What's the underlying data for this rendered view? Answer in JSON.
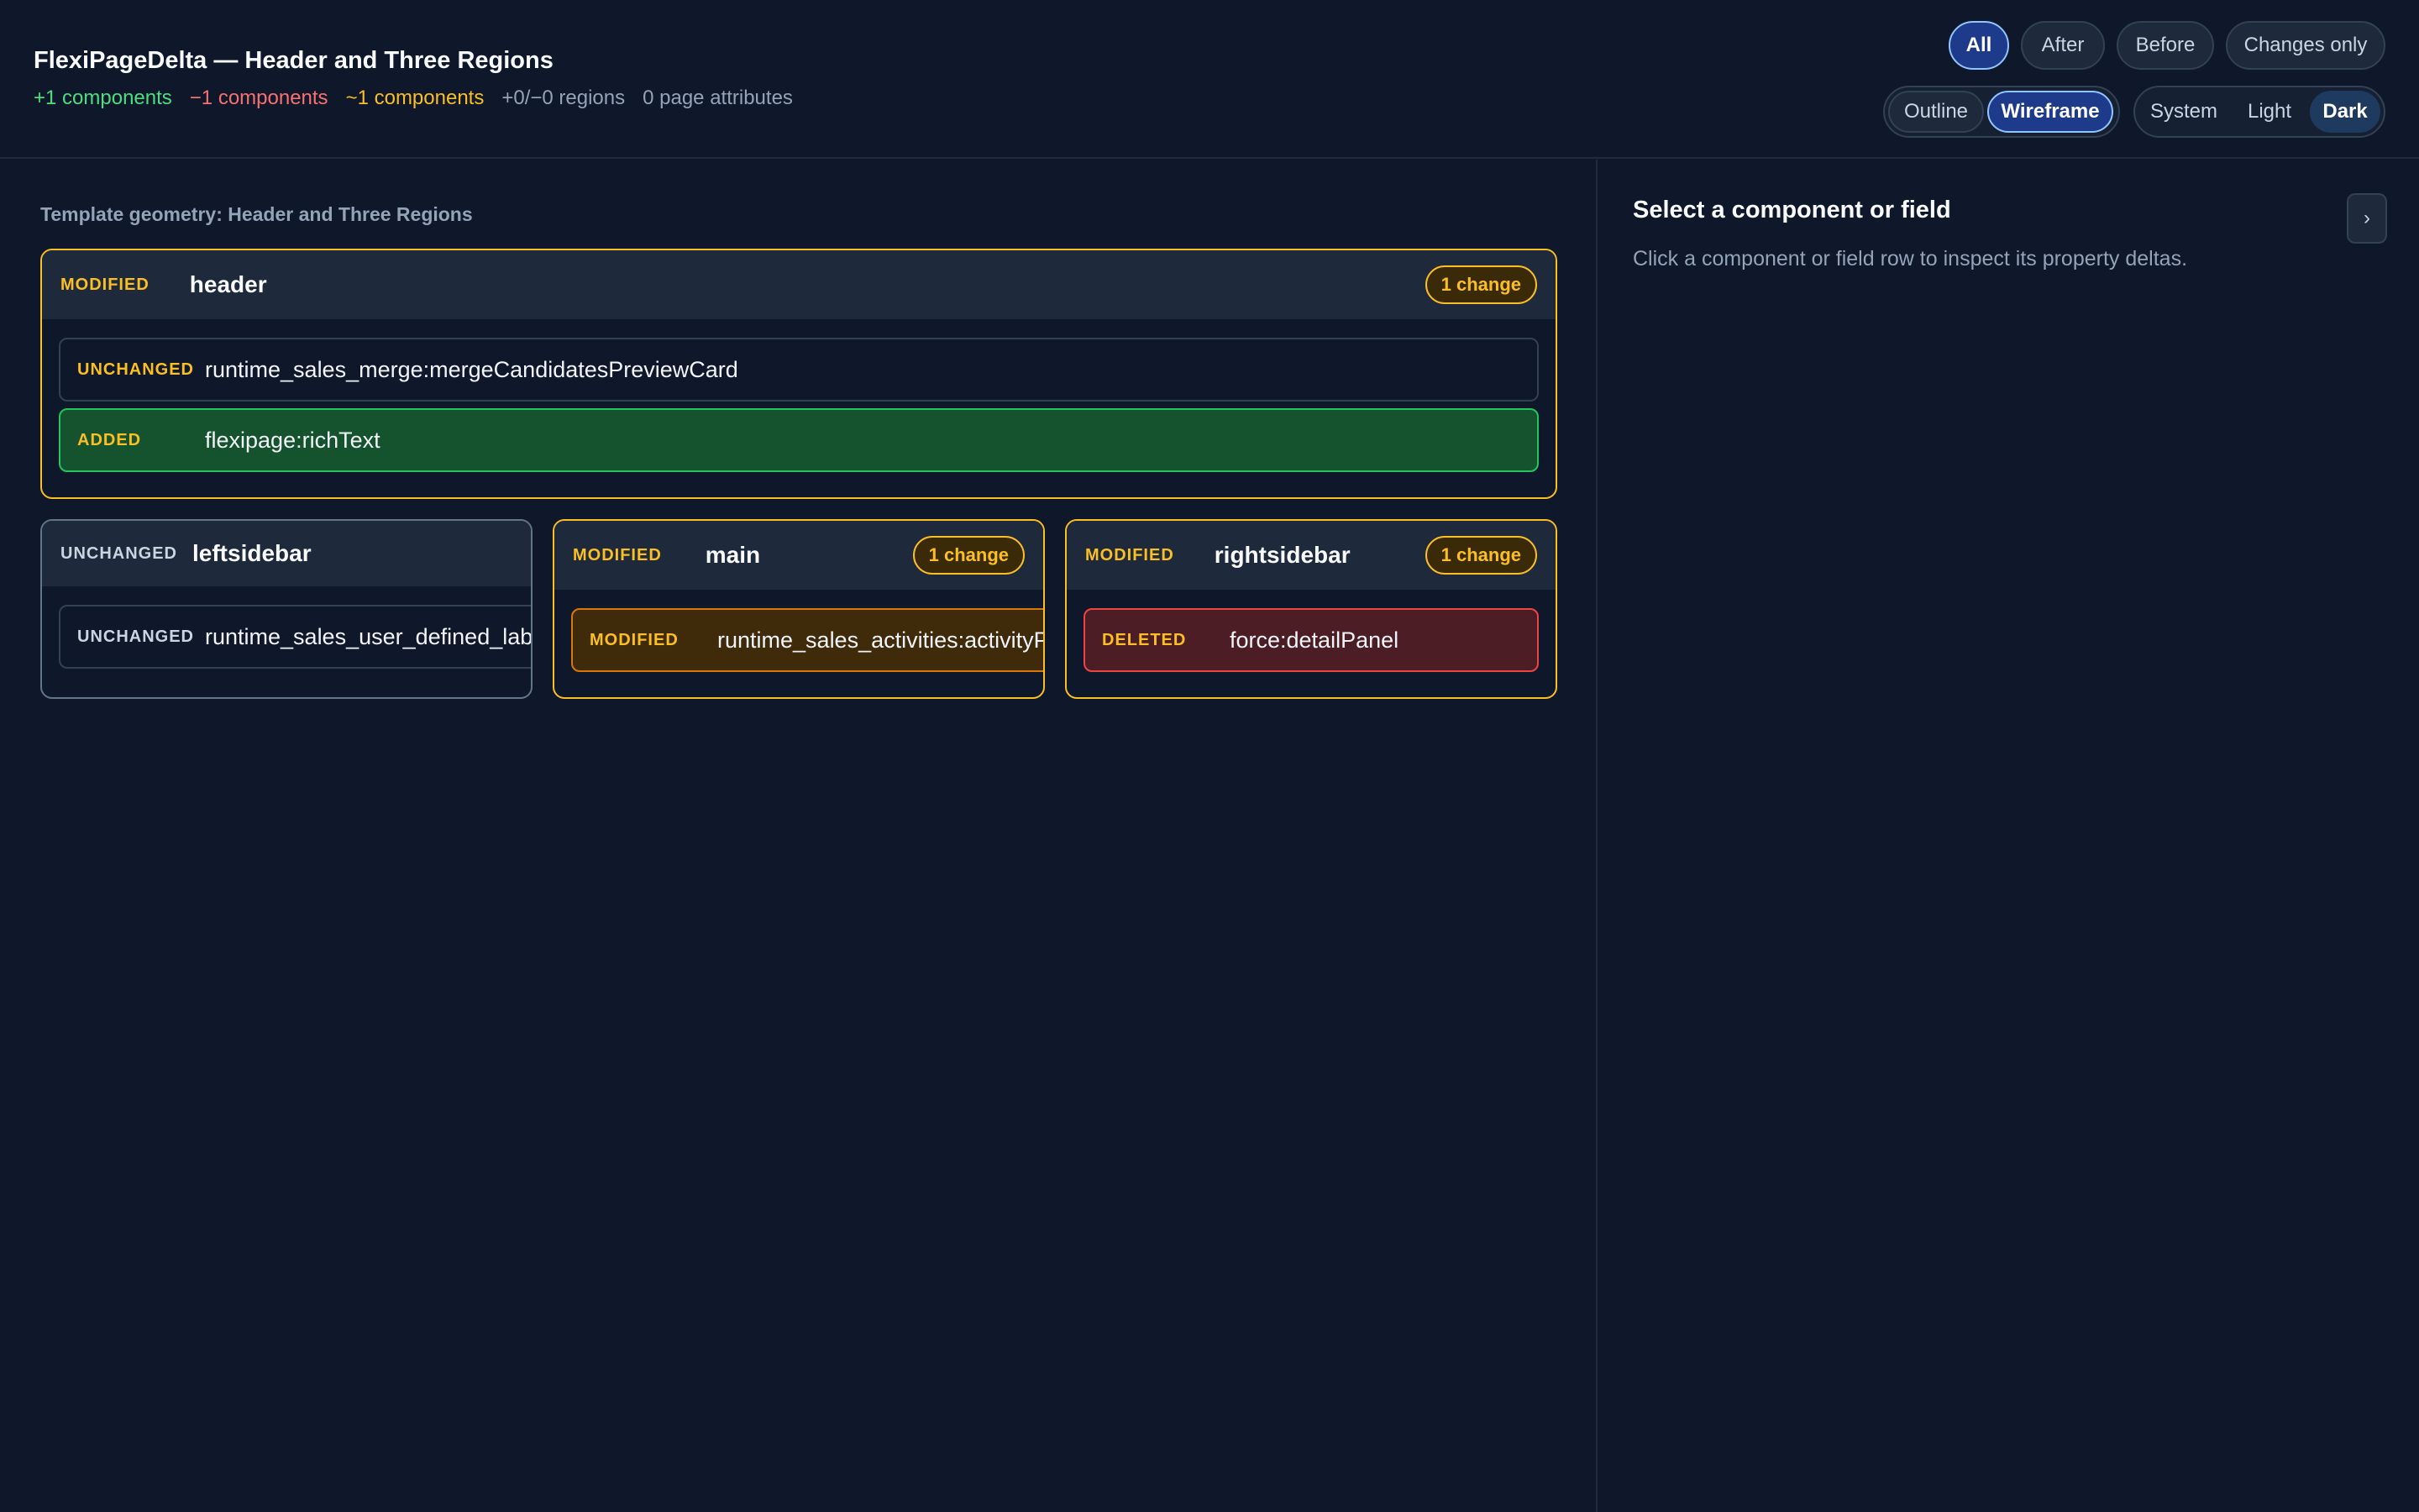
{
  "header": {
    "title": "FlexiPageDelta — Header and Three Regions",
    "summary": {
      "added": "+1 components",
      "deleted": "−1 components",
      "modified": "~1 components",
      "regions": "+0/−0 regions",
      "attributes": "0 page attributes"
    }
  },
  "filters": {
    "all": "All",
    "after": "After",
    "before": "Before",
    "changes_only": "Changes only",
    "selected": "All"
  },
  "view_modes": {
    "outline": "Outline",
    "wireframe": "Wireframe",
    "selected": "Wireframe"
  },
  "themes": {
    "system": "System",
    "light": "Light",
    "dark": "Dark",
    "selected": "Dark"
  },
  "canvas": {
    "geometry_label": "Template geometry: Header and Three Regions",
    "regions": {
      "header": {
        "status": "MODIFIED",
        "name": "header",
        "badge": "1 change",
        "components": [
          {
            "status": "UNCHANGED",
            "name": "runtime_sales_merge:mergeCandidatesPreviewCard"
          },
          {
            "status": "ADDED",
            "name": "flexipage:richText"
          }
        ]
      },
      "leftsidebar": {
        "status": "UNCHANGED",
        "name": "leftsidebar",
        "components": [
          {
            "status": "UNCHANGED",
            "name": "runtime_sales_user_defined_labels"
          }
        ]
      },
      "main": {
        "status": "MODIFIED",
        "name": "main",
        "badge": "1 change",
        "components": [
          {
            "status": "MODIFIED",
            "name": "runtime_sales_activities:activityPanel"
          }
        ]
      },
      "rightsidebar": {
        "status": "MODIFIED",
        "name": "rightsidebar",
        "badge": "1 change",
        "components": [
          {
            "status": "DELETED",
            "name": "force:detailPanel"
          }
        ]
      }
    }
  },
  "inspector": {
    "title": "Select a component or field",
    "description": "Click a component or field row to inspect its property deltas.",
    "collapse_glyph": "›"
  },
  "colors": {
    "background": "#0f172a",
    "added": "#4ade80",
    "deleted": "#f87171",
    "modified": "#fbbf24",
    "accent": "#93c5fd"
  }
}
